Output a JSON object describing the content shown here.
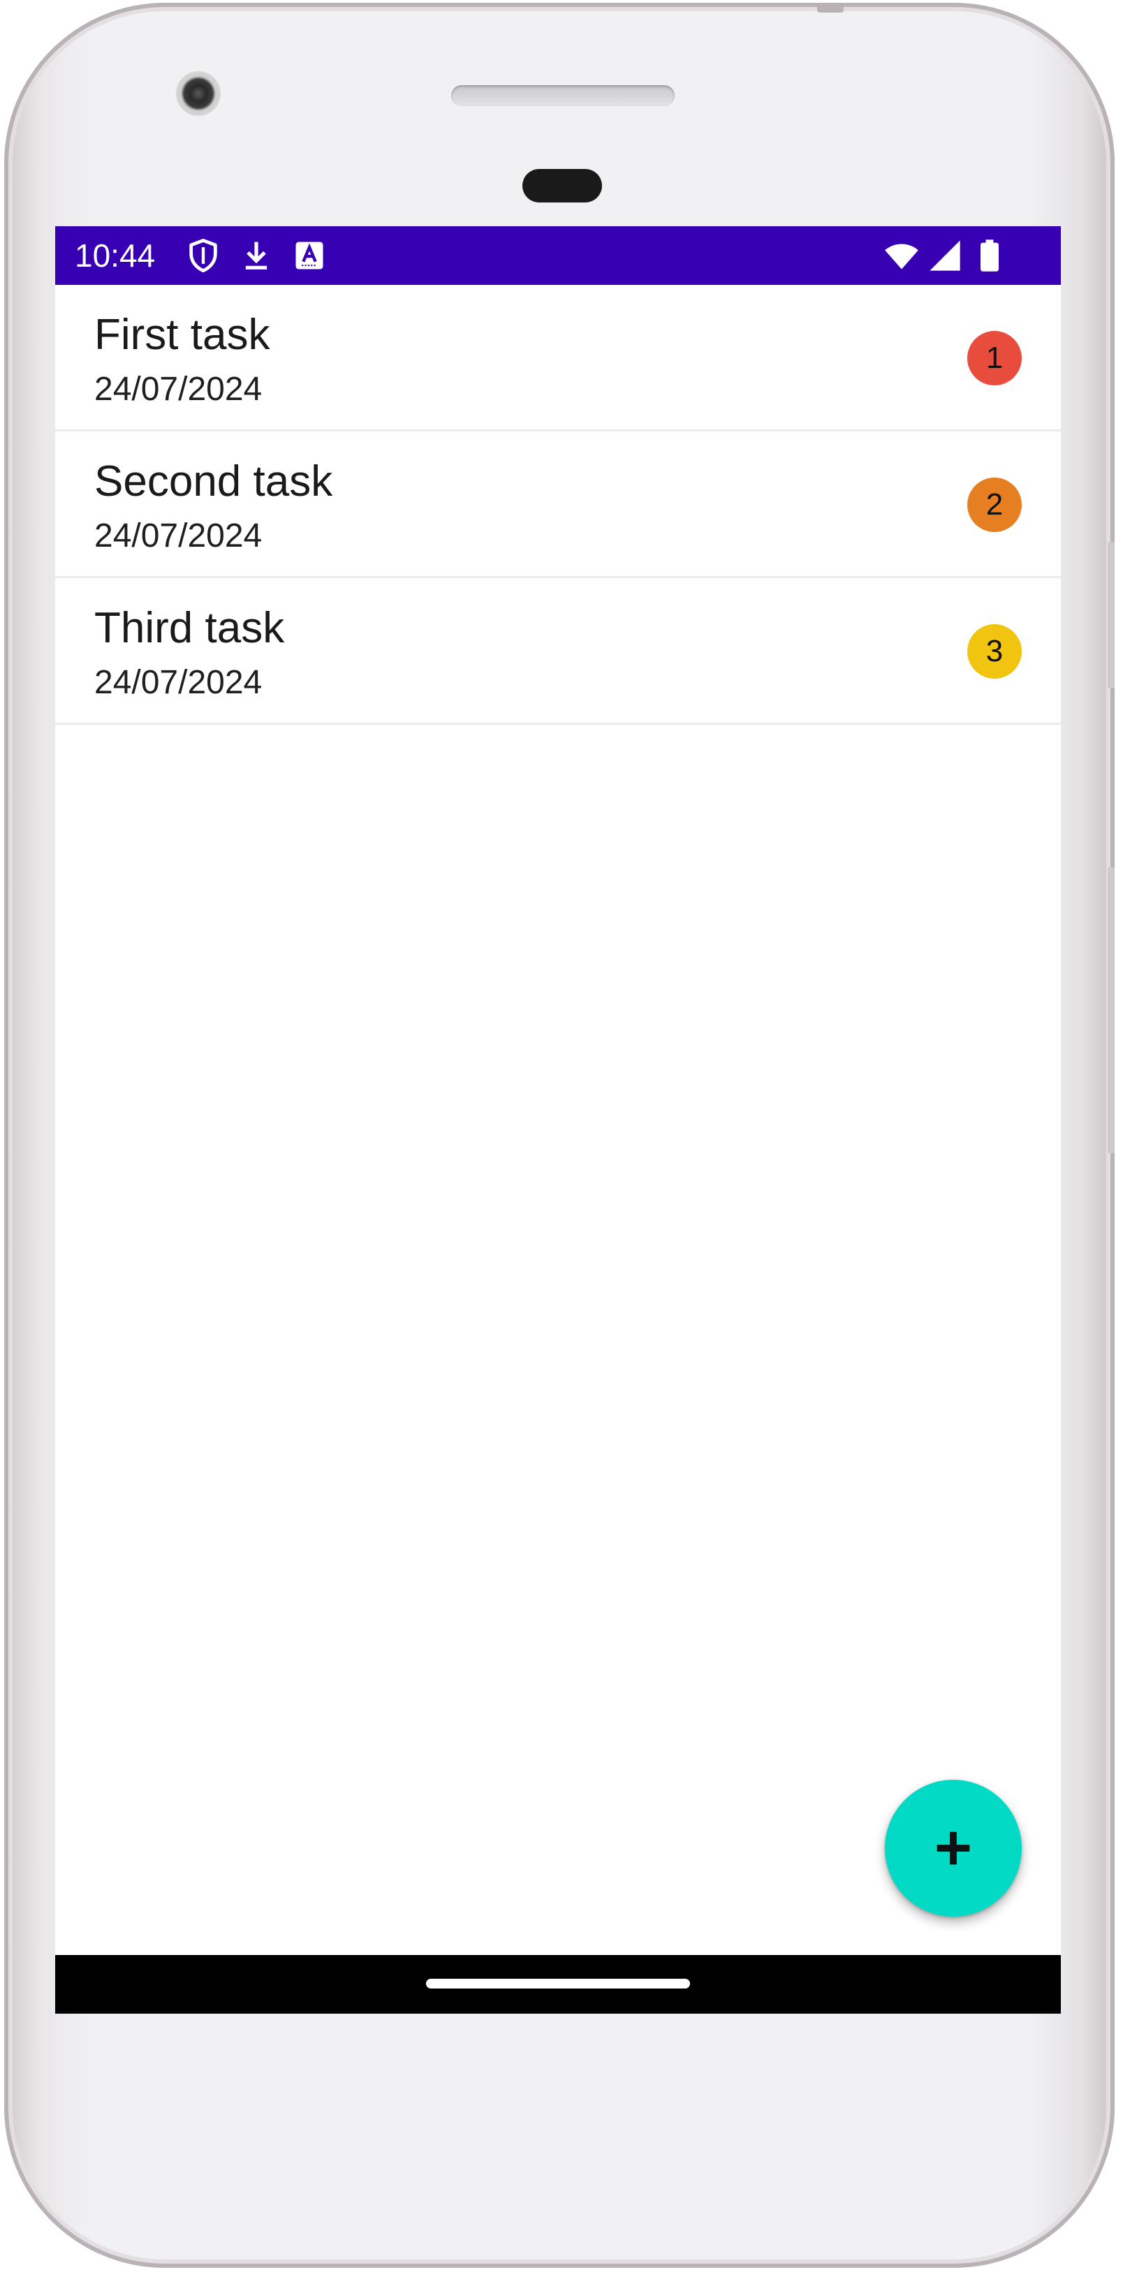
{
  "status_bar": {
    "time": "10:44",
    "icons": [
      "shield-icon",
      "download-icon",
      "keyboard-a-icon",
      "wifi-icon",
      "cellular-signal-icon",
      "battery-icon"
    ],
    "background": "#3700b3"
  },
  "tasks": [
    {
      "title": "First task",
      "date": "24/07/2024",
      "priority": "1",
      "priority_color": "#e74c3c"
    },
    {
      "title": "Second task",
      "date": "24/07/2024",
      "priority": "2",
      "priority_color": "#e67e22"
    },
    {
      "title": "Third task",
      "date": "24/07/2024",
      "priority": "3",
      "priority_color": "#f1c40f"
    }
  ],
  "fab": {
    "icon": "plus-icon",
    "color": "#03dac5"
  }
}
